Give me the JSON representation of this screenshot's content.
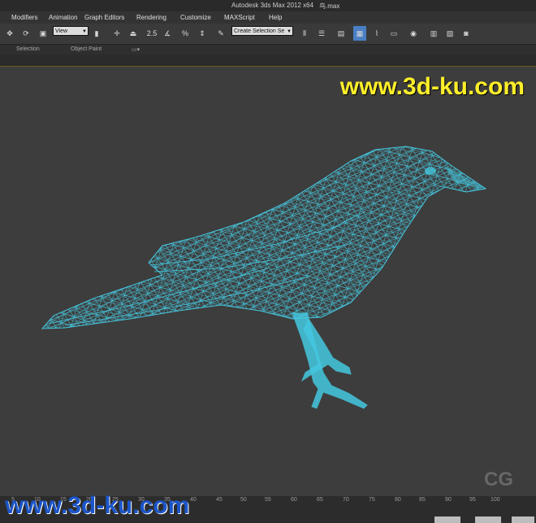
{
  "window": {
    "title": "Autodesk 3ds Max  2012 x64",
    "filename": "鸟.max"
  },
  "menu": [
    "Modifiers",
    "Animation",
    "Graph Editors",
    "Rendering",
    "Customize",
    "MAXScript",
    "Help"
  ],
  "toolbar": {
    "view_dropdown": "View",
    "snap_label": "2.5",
    "selection_set_dropdown": "Create Selection Se"
  },
  "ribbon": {
    "selection": "Selection",
    "object_paint": "Object Paint"
  },
  "timeline": {
    "ticks": [
      "5",
      "10",
      "15",
      "20",
      "25",
      "30",
      "35",
      "40",
      "45",
      "50",
      "55",
      "60",
      "65",
      "70",
      "75",
      "80",
      "85",
      "90",
      "95",
      "100"
    ],
    "right_ticks": [
      "0",
      "5",
      "10",
      "15",
      "20",
      "25"
    ]
  },
  "watermarks": {
    "top": "www.3d-ku.com",
    "bottom": "www.3d-ku.com",
    "corner": "CG"
  },
  "colors": {
    "wireframe": "#45c8e0",
    "viewport_bg": "#3d3d3d",
    "watermark_top": "#ffef2a",
    "watermark_bottom": "#1b55c9"
  }
}
